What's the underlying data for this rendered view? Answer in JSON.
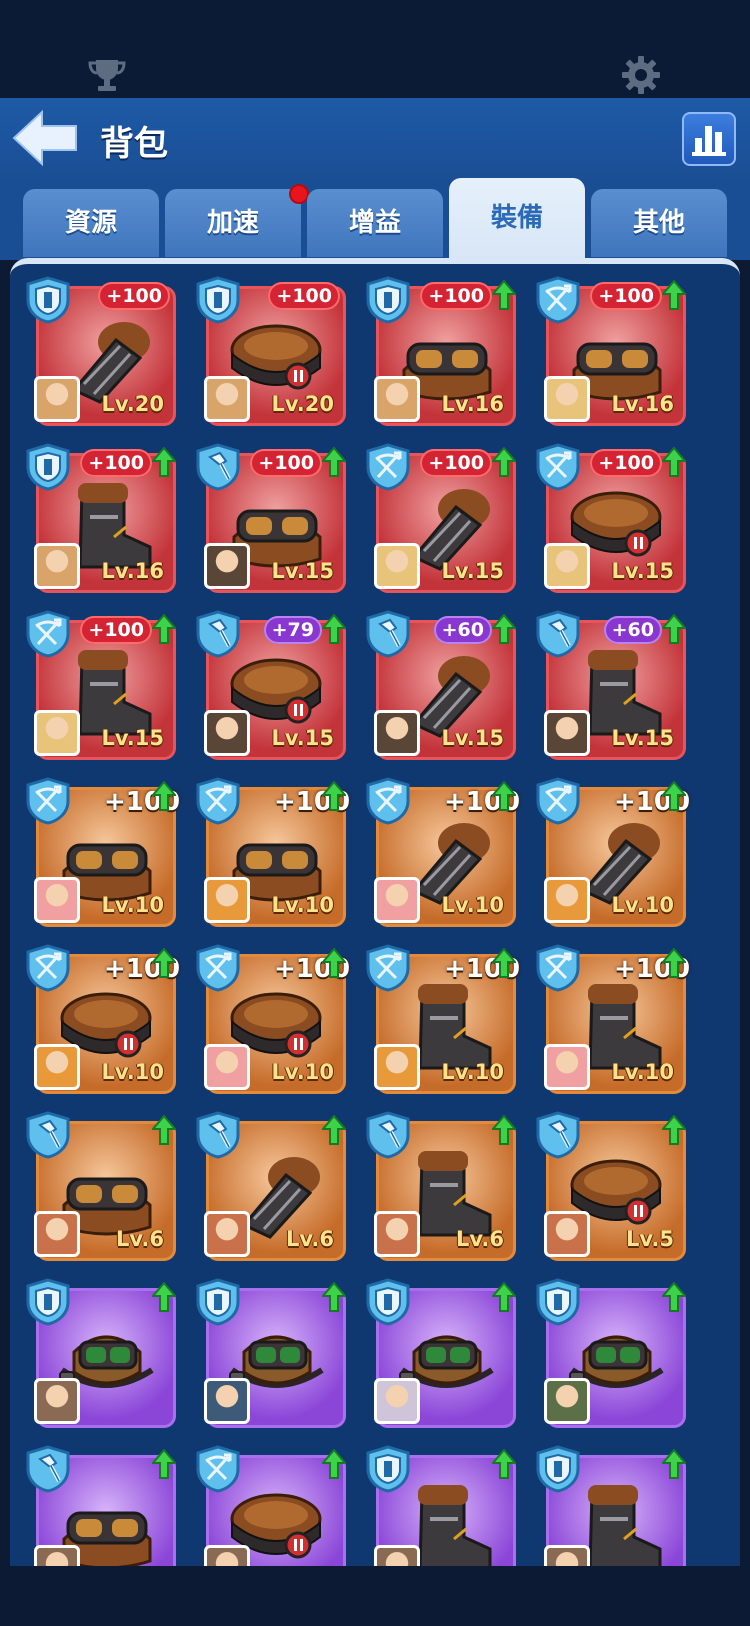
{
  "header": {
    "title": "背包"
  },
  "tabs": [
    {
      "label": "資源",
      "active": false,
      "has_dot": false
    },
    {
      "label": "加速",
      "active": false,
      "has_dot": true
    },
    {
      "label": "增益",
      "active": false,
      "has_dot": false
    },
    {
      "label": "裝備",
      "active": true,
      "has_dot": false
    },
    {
      "label": "其他",
      "active": false,
      "has_dot": false
    }
  ],
  "colors": {
    "red": "#c3343a",
    "orange": "#c66c2a",
    "purple": "#8b46d8",
    "upgrade_arrow": "#3ed14a"
  },
  "items": [
    {
      "rarity": "red",
      "slot": "shield-icon",
      "bonus": "+100",
      "bonus_style": "pill-red",
      "upgrade": false,
      "level": "Lv.20",
      "equip": "gauntlet",
      "avatar": "#d9a46a"
    },
    {
      "rarity": "red",
      "slot": "shield-icon",
      "bonus": "+100",
      "bonus_style": "pill-red",
      "upgrade": false,
      "level": "Lv.20",
      "equip": "belt",
      "avatar": "#d9a46a"
    },
    {
      "rarity": "red",
      "slot": "shield-icon",
      "bonus": "+100",
      "bonus_style": "pill-red",
      "upgrade": true,
      "level": "Lv.16",
      "equip": "goggles",
      "avatar": "#d9a46a"
    },
    {
      "rarity": "red",
      "slot": "crossbow-icon",
      "bonus": "+100",
      "bonus_style": "pill-red",
      "upgrade": true,
      "level": "Lv.16",
      "equip": "goggles",
      "avatar": "#e8c47a"
    },
    {
      "rarity": "red",
      "slot": "shield-icon",
      "bonus": "+100",
      "bonus_style": "pill-red",
      "upgrade": true,
      "level": "Lv.16",
      "equip": "boot",
      "avatar": "#d9a46a"
    },
    {
      "rarity": "red",
      "slot": "hammer-icon",
      "bonus": "+100",
      "bonus_style": "pill-red",
      "upgrade": true,
      "level": "Lv.15",
      "equip": "goggles",
      "avatar": "#5a4636"
    },
    {
      "rarity": "red",
      "slot": "crossbow-icon",
      "bonus": "+100",
      "bonus_style": "pill-red",
      "upgrade": true,
      "level": "Lv.15",
      "equip": "gauntlet",
      "avatar": "#e8c47a"
    },
    {
      "rarity": "red",
      "slot": "crossbow-icon",
      "bonus": "+100",
      "bonus_style": "pill-red",
      "upgrade": true,
      "level": "Lv.15",
      "equip": "belt",
      "avatar": "#e8c47a"
    },
    {
      "rarity": "red",
      "slot": "crossbow-icon",
      "bonus": "+100",
      "bonus_style": "pill-red",
      "upgrade": true,
      "level": "Lv.15",
      "equip": "boot",
      "avatar": "#e8c47a"
    },
    {
      "rarity": "red",
      "slot": "hammer-icon",
      "bonus": "+79",
      "bonus_style": "pill-purple",
      "upgrade": true,
      "level": "Lv.15",
      "equip": "belt",
      "avatar": "#5a4636"
    },
    {
      "rarity": "red",
      "slot": "hammer-icon",
      "bonus": "+60",
      "bonus_style": "pill-purple",
      "upgrade": true,
      "level": "Lv.15",
      "equip": "gauntlet",
      "avatar": "#5a4636"
    },
    {
      "rarity": "red",
      "slot": "hammer-icon",
      "bonus": "+60",
      "bonus_style": "pill-purple",
      "upgrade": true,
      "level": "Lv.15",
      "equip": "boot",
      "avatar": "#5a4636"
    },
    {
      "rarity": "orange",
      "slot": "crossbow-icon",
      "bonus": "+100",
      "bonus_style": "plain",
      "upgrade": true,
      "level": "Lv.10",
      "equip": "goggles",
      "avatar": "#f0a0a0"
    },
    {
      "rarity": "orange",
      "slot": "crossbow-icon",
      "bonus": "+100",
      "bonus_style": "plain",
      "upgrade": true,
      "level": "Lv.10",
      "equip": "goggles",
      "avatar": "#e89a3a"
    },
    {
      "rarity": "orange",
      "slot": "crossbow-icon",
      "bonus": "+100",
      "bonus_style": "plain",
      "upgrade": true,
      "level": "Lv.10",
      "equip": "gauntlet",
      "avatar": "#f0a0a0"
    },
    {
      "rarity": "orange",
      "slot": "crossbow-icon",
      "bonus": "+100",
      "bonus_style": "plain",
      "upgrade": true,
      "level": "Lv.10",
      "equip": "gauntlet",
      "avatar": "#e89a3a"
    },
    {
      "rarity": "orange",
      "slot": "crossbow-icon",
      "bonus": "+100",
      "bonus_style": "plain",
      "upgrade": true,
      "level": "Lv.10",
      "equip": "belt",
      "avatar": "#e89a3a"
    },
    {
      "rarity": "orange",
      "slot": "crossbow-icon",
      "bonus": "+100",
      "bonus_style": "plain",
      "upgrade": true,
      "level": "Lv.10",
      "equip": "belt",
      "avatar": "#f0a0a0"
    },
    {
      "rarity": "orange",
      "slot": "crossbow-icon",
      "bonus": "+100",
      "bonus_style": "plain",
      "upgrade": true,
      "level": "Lv.10",
      "equip": "boot",
      "avatar": "#e89a3a"
    },
    {
      "rarity": "orange",
      "slot": "crossbow-icon",
      "bonus": "+100",
      "bonus_style": "plain",
      "upgrade": true,
      "level": "Lv.10",
      "equip": "boot",
      "avatar": "#f0a0a0"
    },
    {
      "rarity": "orange",
      "slot": "hammer-icon",
      "bonus": "",
      "bonus_style": "none",
      "upgrade": true,
      "level": "Lv.6",
      "equip": "goggles",
      "avatar": "#c9714a"
    },
    {
      "rarity": "orange",
      "slot": "hammer-icon",
      "bonus": "",
      "bonus_style": "none",
      "upgrade": true,
      "level": "Lv.6",
      "equip": "gauntlet",
      "avatar": "#c9714a"
    },
    {
      "rarity": "orange",
      "slot": "hammer-icon",
      "bonus": "",
      "bonus_style": "none",
      "upgrade": true,
      "level": "Lv.6",
      "equip": "boot",
      "avatar": "#c9714a"
    },
    {
      "rarity": "orange",
      "slot": "hammer-icon",
      "bonus": "",
      "bonus_style": "none",
      "upgrade": true,
      "level": "Lv.5",
      "equip": "belt",
      "avatar": "#c9714a"
    },
    {
      "rarity": "purple",
      "slot": "shield-icon",
      "bonus": "",
      "bonus_style": "none",
      "upgrade": true,
      "level": "",
      "equip": "green-goggles",
      "avatar": "#8a6a52"
    },
    {
      "rarity": "purple",
      "slot": "shield-icon",
      "bonus": "",
      "bonus_style": "none",
      "upgrade": true,
      "level": "",
      "equip": "green-goggles",
      "avatar": "#3d5a78"
    },
    {
      "rarity": "purple",
      "slot": "shield-icon",
      "bonus": "",
      "bonus_style": "none",
      "upgrade": true,
      "level": "",
      "equip": "green-goggles",
      "avatar": "#d0c4d8"
    },
    {
      "rarity": "purple",
      "slot": "shield-icon",
      "bonus": "",
      "bonus_style": "none",
      "upgrade": true,
      "level": "",
      "equip": "green-goggles",
      "avatar": "#5c7048"
    },
    {
      "rarity": "purple",
      "slot": "hammer-icon",
      "bonus": "",
      "bonus_style": "none",
      "upgrade": true,
      "level": "",
      "equip": "goggles",
      "avatar": "#8a6a52"
    },
    {
      "rarity": "purple",
      "slot": "crossbow-icon",
      "bonus": "",
      "bonus_style": "none",
      "upgrade": true,
      "level": "",
      "equip": "belt",
      "avatar": "#8a6a52"
    },
    {
      "rarity": "purple",
      "slot": "shield-icon",
      "bonus": "",
      "bonus_style": "none",
      "upgrade": true,
      "level": "",
      "equip": "boot",
      "avatar": "#8a6a52"
    },
    {
      "rarity": "purple",
      "slot": "shield-icon",
      "bonus": "",
      "bonus_style": "none",
      "upgrade": true,
      "level": "",
      "equip": "boot",
      "avatar": "#8a6a52"
    }
  ]
}
